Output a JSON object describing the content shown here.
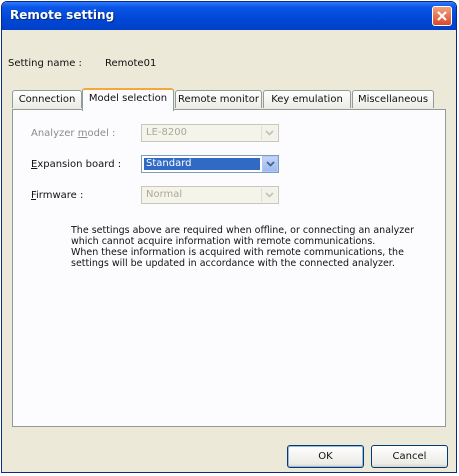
{
  "window": {
    "title": "Remote setting"
  },
  "setting": {
    "label": "Setting name :",
    "value": "Remote01"
  },
  "tabs": [
    {
      "label": "Connection"
    },
    {
      "label": "Model selection"
    },
    {
      "label": "Remote monitor"
    },
    {
      "label": "Key emulation"
    },
    {
      "label": "Miscellaneous"
    }
  ],
  "fields": {
    "analyzer_model": {
      "label_pre": "Analyzer ",
      "label_accel": "m",
      "label_post": "odel :",
      "value": "LE-8200"
    },
    "expansion_board": {
      "label_pre": "",
      "label_accel": "E",
      "label_post": "xpansion board :",
      "value": "Standard"
    },
    "firmware": {
      "label_pre": "",
      "label_accel": "F",
      "label_post": "irmware :",
      "value": "Normal"
    }
  },
  "note": {
    "line1": "The settings above are required when offline, or connecting an analyzer",
    "line2": "which cannot acquire information with remote communications.",
    "line3": "When these information is acquired with remote communications, the",
    "line4": "settings will be updated in accordance with the connected analyzer."
  },
  "buttons": {
    "ok": "OK",
    "cancel": "Cancel"
  },
  "colors": {
    "titlebar": "#0047d6",
    "tab_highlight": "#f6a73b",
    "selection": "#316ac5",
    "dialog_bg": "#ece9d8"
  },
  "icons": {
    "close": "close-icon",
    "dropdown": "chevron-down-icon"
  }
}
